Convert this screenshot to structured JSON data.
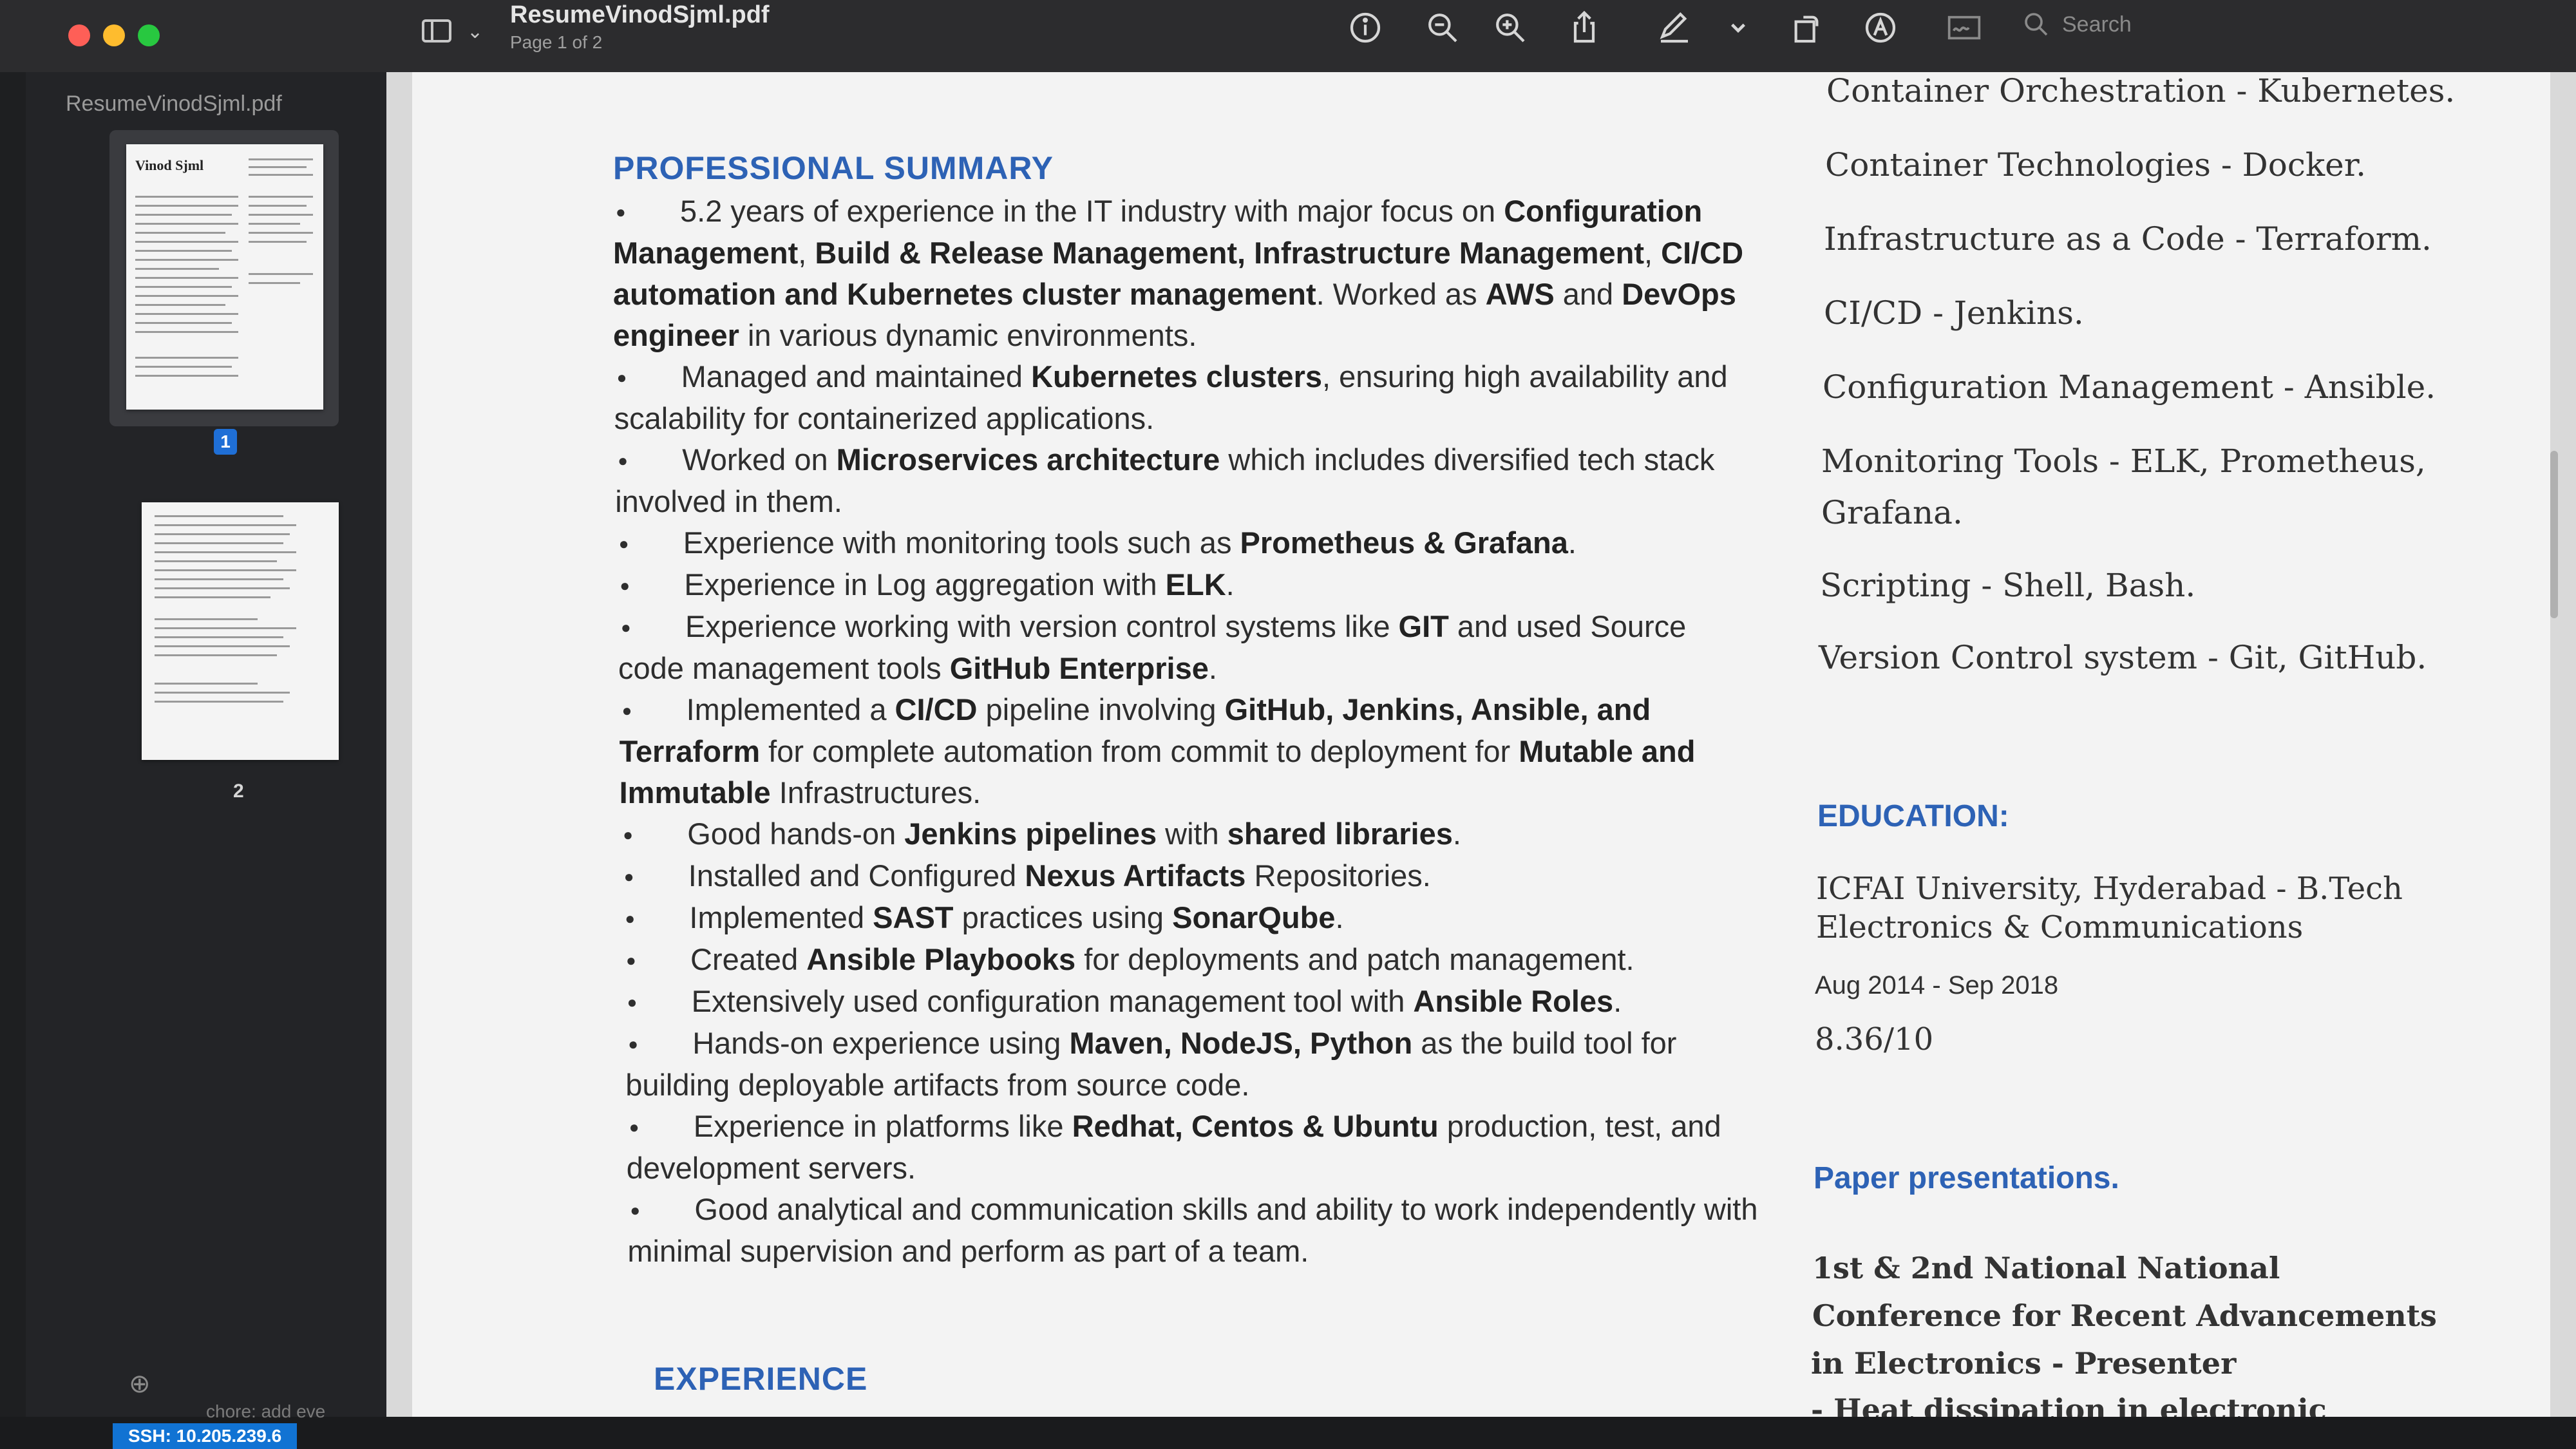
{
  "window": {
    "document_title": "ResumeVinodSjml.pdf",
    "page_indicator": "Page 1 of 2"
  },
  "toolbar": {
    "icons": [
      "info-icon",
      "zoom-out-icon",
      "zoom-in-icon",
      "share-icon",
      "markup-pen-icon",
      "chevron-down-icon",
      "rotate-icon",
      "annotate-icon",
      "signature-icon",
      "search-icon"
    ],
    "search_placeholder": "Search"
  },
  "sidebar": {
    "filename": "ResumeVinodSjml.pdf",
    "thumbnail_1_title": "Vinod Sjml",
    "pages": [
      {
        "label": "1",
        "selected": true
      },
      {
        "label": "2",
        "selected": false
      }
    ]
  },
  "resume": {
    "summary_heading": "PROFESSIONAL SUMMARY",
    "summary_items": [
      {
        "html": "5.2 years of experience in the IT industry with major focus on <b>Configuration Management</b>, <b>Build &amp; Release Management, Infrastructure Management</b>, <b>CI/CD automation and Kubernetes cluster management</b>. Worked as <b>AWS</b> and <b>DevOps engineer</b> in various dynamic environments."
      },
      {
        "html": "Managed and maintained <b>Kubernetes clusters</b>, ensuring high availability and scalability for containerized applications."
      },
      {
        "html": "Worked on <b>Microservices architecture</b> which includes diversified tech stack involved in them."
      },
      {
        "html": "Experience with monitoring tools such as <b>Prometheus &amp; Grafana</b>."
      },
      {
        "html": "Experience in Log aggregation with <b>ELK</b>."
      },
      {
        "html": "Experience working with version control systems like <b>GIT</b> and used Source code management tools <b>GitHub Enterprise</b>."
      },
      {
        "html": "Implemented a <b>CI/CD</b> pipeline involving <b>GitHub, Jenkins, Ansible, and Terraform</b> for complete automation from commit to deployment for <b>Mutable and Immutable</b> Infrastructures."
      },
      {
        "html": "Good hands-on <b>Jenkins pipelines</b> with <b>shared libraries</b>."
      },
      {
        "html": "Installed and Configured <b>Nexus Artifacts</b> Repositories."
      },
      {
        "html": "Implemented <b>SAST</b> practices using <b>SonarQube</b>."
      },
      {
        "html": "Created <b>Ansible Playbooks</b> for deployments and patch management."
      },
      {
        "html": "Extensively used configuration management tool with <b>Ansible Roles</b>."
      },
      {
        "html": "Hands-on experience using <b>Maven, NodeJS, Python</b> as the build tool for building deployable artifacts from source code."
      },
      {
        "html": "Experience in platforms like <b>Redhat, Centos &amp; Ubuntu</b> production, test, and development servers."
      },
      {
        "html": "Good analytical and communication skills and ability to work independently with minimal supervision and perform as part of a team."
      }
    ],
    "experience_heading": "EXPERIENCE",
    "skills": [
      "Container Orchestration - Kubernetes.",
      "Container Technologies - Docker.",
      "Infrastructure as a Code - Terraform.",
      "CI/CD - Jenkins.",
      "Configuration Management - Ansible.",
      "Monitoring Tools - ELK, Prometheus,",
      "Grafana.",
      "Scripting - Shell, Bash.",
      "Version Control system - Git, GitHub."
    ],
    "education_heading": "EDUCATION:",
    "education_line1": "ICFAI University, Hyderabad - B.Tech",
    "education_line2": "Electronics & Communications",
    "education_dates": "Aug  2014 - Sep 2018",
    "education_gpa": "8.36/10",
    "presentations_heading": "Paper presentations.",
    "presentation_lines": [
      "1st & 2nd National National",
      "Conference for Recent Advancements",
      "in Electronics - Presenter",
      "- Heat dissipation in electronic"
    ]
  },
  "statusbar": {
    "ssh_label": "SSH: 10.205.239.6",
    "commit_text": "chore: add eve"
  },
  "colors": {
    "heading_blue": "#2d62b5",
    "selection_blue": "#1f6fd6",
    "ssh_blue": "#1173d3"
  }
}
